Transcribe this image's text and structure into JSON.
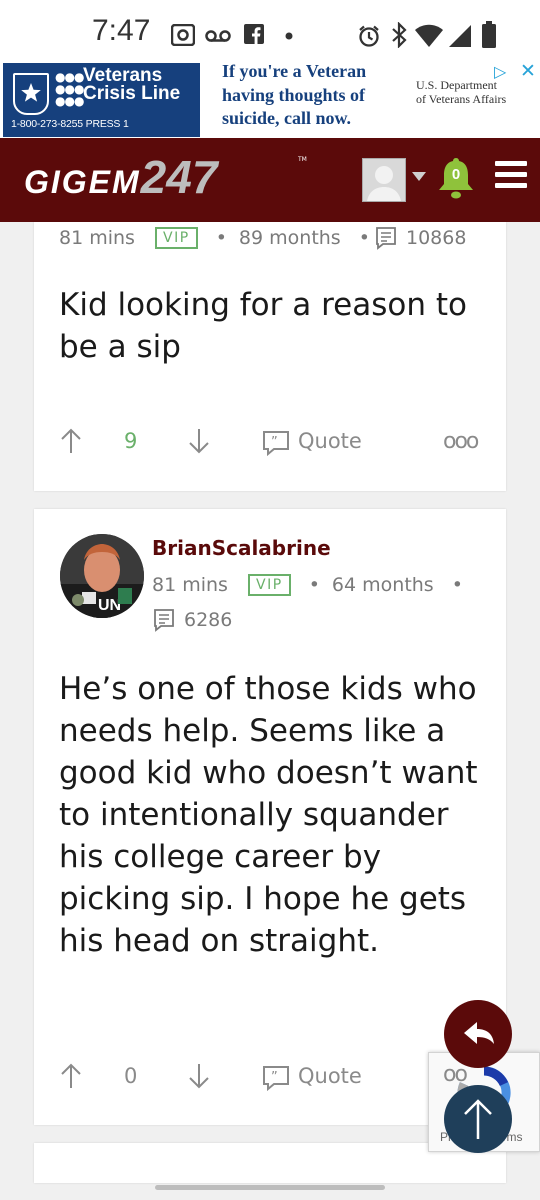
{
  "status_bar": {
    "time": "7:47"
  },
  "ad": {
    "left_title": "Veterans\nCrisis Line",
    "left_phone": "1-800-273-8255 PRESS 1",
    "message": "If you're a Veteran having thoughts of suicide, call now.",
    "sponsor": "U.S. Department\nof Veterans Affairs",
    "colors": {
      "navy": "#16407d",
      "choices": "#27a3d8"
    }
  },
  "header": {
    "logo": "GIGEM",
    "logo_number": "247",
    "notification_count": "0",
    "colors": {
      "bar": "#5b0a0a",
      "bell": "#8fc23b"
    }
  },
  "posts": [
    {
      "time": "81 mins",
      "badge": "VIP",
      "tenure": "89 months",
      "post_count": "10868",
      "body": "Kid looking for a reason to be a sip",
      "upvotes": "9",
      "quote_label": "Quote"
    },
    {
      "username": "BrianScalabrine",
      "time": "81 mins",
      "badge": "VIP",
      "tenure": "64 months",
      "post_count": "6286",
      "body": "He’s one of those kids who needs help. Seems like a good kid who doesn’t want to intentionally squander his college career by picking sip. I hope he gets his head on straight.",
      "upvotes": "0",
      "quote_label": "Quote"
    }
  ],
  "recaptcha": {
    "terms": "Privacy - Terms"
  },
  "colors": {
    "upvote_green": "#6ab06a",
    "username": "#5a0a0a",
    "fab_top": "#1f3f5a"
  }
}
